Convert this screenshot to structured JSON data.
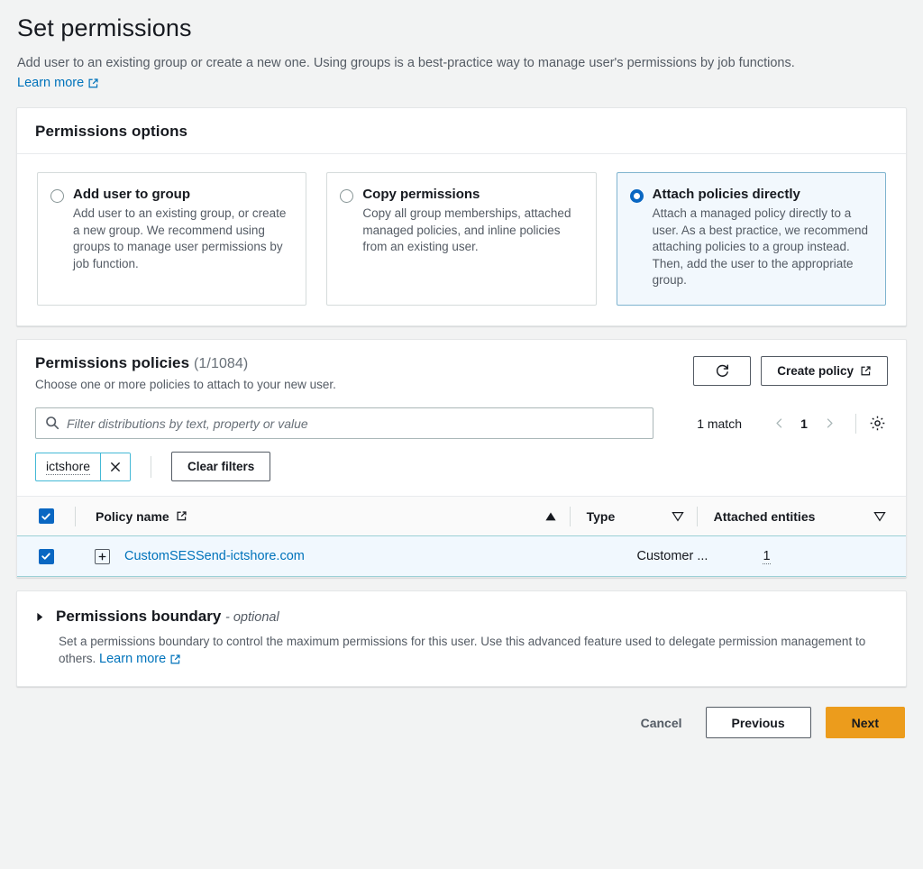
{
  "header": {
    "title": "Set permissions",
    "description": "Add user to an existing group or create a new one. Using groups is a best-practice way to manage user's permissions by job functions.",
    "learn_more": "Learn more"
  },
  "permissions_options": {
    "title": "Permissions options",
    "tiles": [
      {
        "id": "add-user-to-group",
        "title": "Add user to group",
        "description": "Add user to an existing group, or create a new group. We recommend using groups to manage user permissions by job function.",
        "selected": false
      },
      {
        "id": "copy-permissions",
        "title": "Copy permissions",
        "description": "Copy all group memberships, attached managed policies, and inline policies from an existing user.",
        "selected": false
      },
      {
        "id": "attach-policies-directly",
        "title": "Attach policies directly",
        "description": "Attach a managed policy directly to a user. As a best practice, we recommend attaching policies to a group instead. Then, add the user to the appropriate group.",
        "selected": true
      }
    ]
  },
  "permissions_policies": {
    "title": "Permissions policies",
    "count": "(1/1084)",
    "subtitle": "Choose one or more policies to attach to your new user.",
    "refresh_label": "refresh-icon",
    "create_policy_label": "Create policy",
    "search": {
      "placeholder": "Filter distributions by text, property or value",
      "value": ""
    },
    "match_text": "1 match",
    "page_number": "1",
    "filter_token": "ictshore",
    "clear_filters_label": "Clear filters",
    "table": {
      "columns": [
        {
          "label": "Policy name",
          "sort": "asc",
          "external": true
        },
        {
          "label": "Type",
          "sort": "none",
          "external": false
        },
        {
          "label": "Attached entities",
          "sort": "none",
          "external": false
        }
      ],
      "header_checkbox_checked": true,
      "rows": [
        {
          "checked": true,
          "policy_name": "CustomSESSend-ictshore.com",
          "type": "Customer ...",
          "attached_entities": "1"
        }
      ]
    }
  },
  "permissions_boundary": {
    "title": "Permissions boundary",
    "optional": "- optional",
    "description": "Set a permissions boundary to control the maximum permissions for this user. Use this advanced feature used to delegate permission management to others.",
    "learn_more": "Learn more",
    "expanded": false
  },
  "footer": {
    "cancel": "Cancel",
    "previous": "Previous",
    "next": "Next"
  },
  "colors": {
    "accent_blue": "#0a67c2",
    "link_blue": "#0073bb",
    "next_orange": "#ec9c1c",
    "selected_row": "#f1f8fe",
    "selected_tile": "#f2f8fd",
    "page_bg": "#f2f3f3"
  }
}
